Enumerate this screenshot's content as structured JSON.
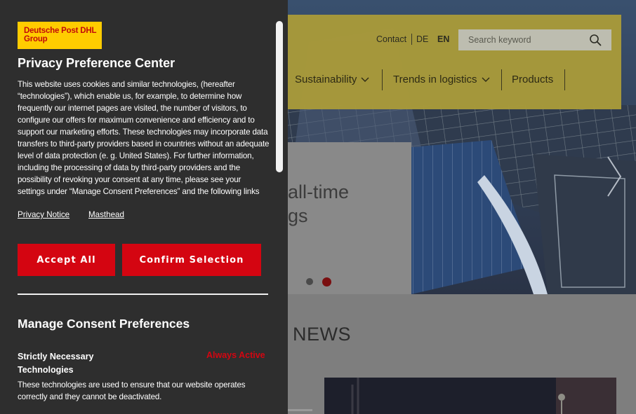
{
  "brand": {
    "logo_text": "Deutsche Post DHL Group",
    "logo_bg": "#ffcc00",
    "logo_fg": "#c20a0a"
  },
  "privacy": {
    "title": "Privacy Preference Center",
    "description": "This website uses cookies and similar technologies, (hereafter “technologies”), which enable us, for example, to determine how frequently our internet pages are visited, the number of visitors, to configure our offers for maximum convenience and efficiency and to support our marketing efforts. These technologies may incorporate data transfers to third-party providers based in countries without an adequate level of data protection (e. g. United States). For further information, including the processing of data by third-party providers and the possibility of revoking your consent at any time, please see your settings under “Manage Consent Preferences” and the following links",
    "links": {
      "privacy_notice": "Privacy Notice",
      "masthead": "Masthead"
    },
    "buttons": {
      "accept_all": "Accept All",
      "confirm_selection": "Confirm Selection"
    },
    "manage": {
      "title": "Manage Consent Preferences",
      "categories": [
        {
          "name": "Strictly Necessary Technologies",
          "status": "Always Active",
          "description": "These technologies are used to ensure that our website operates correctly and they cannot be deactivated."
        }
      ]
    },
    "accent_color": "#d40511",
    "panel_bg": "#2e2e2e"
  },
  "site": {
    "utility": {
      "contact": "Contact",
      "lang_de": "DE",
      "lang_en": "EN",
      "search_placeholder": "Search keyword"
    },
    "nav": [
      {
        "label": "Sustainability",
        "has_dropdown": true,
        "icon": "chevron-down-icon"
      },
      {
        "label": "Trends in logistics",
        "has_dropdown": true,
        "icon": "chevron-down-icon"
      },
      {
        "label": "Products",
        "has_dropdown": false
      }
    ],
    "hero": {
      "title_line_1": "all-time",
      "title_line_2": "gs",
      "slides_total": 2,
      "active_slide": 2
    },
    "news_title": "NEWS"
  }
}
